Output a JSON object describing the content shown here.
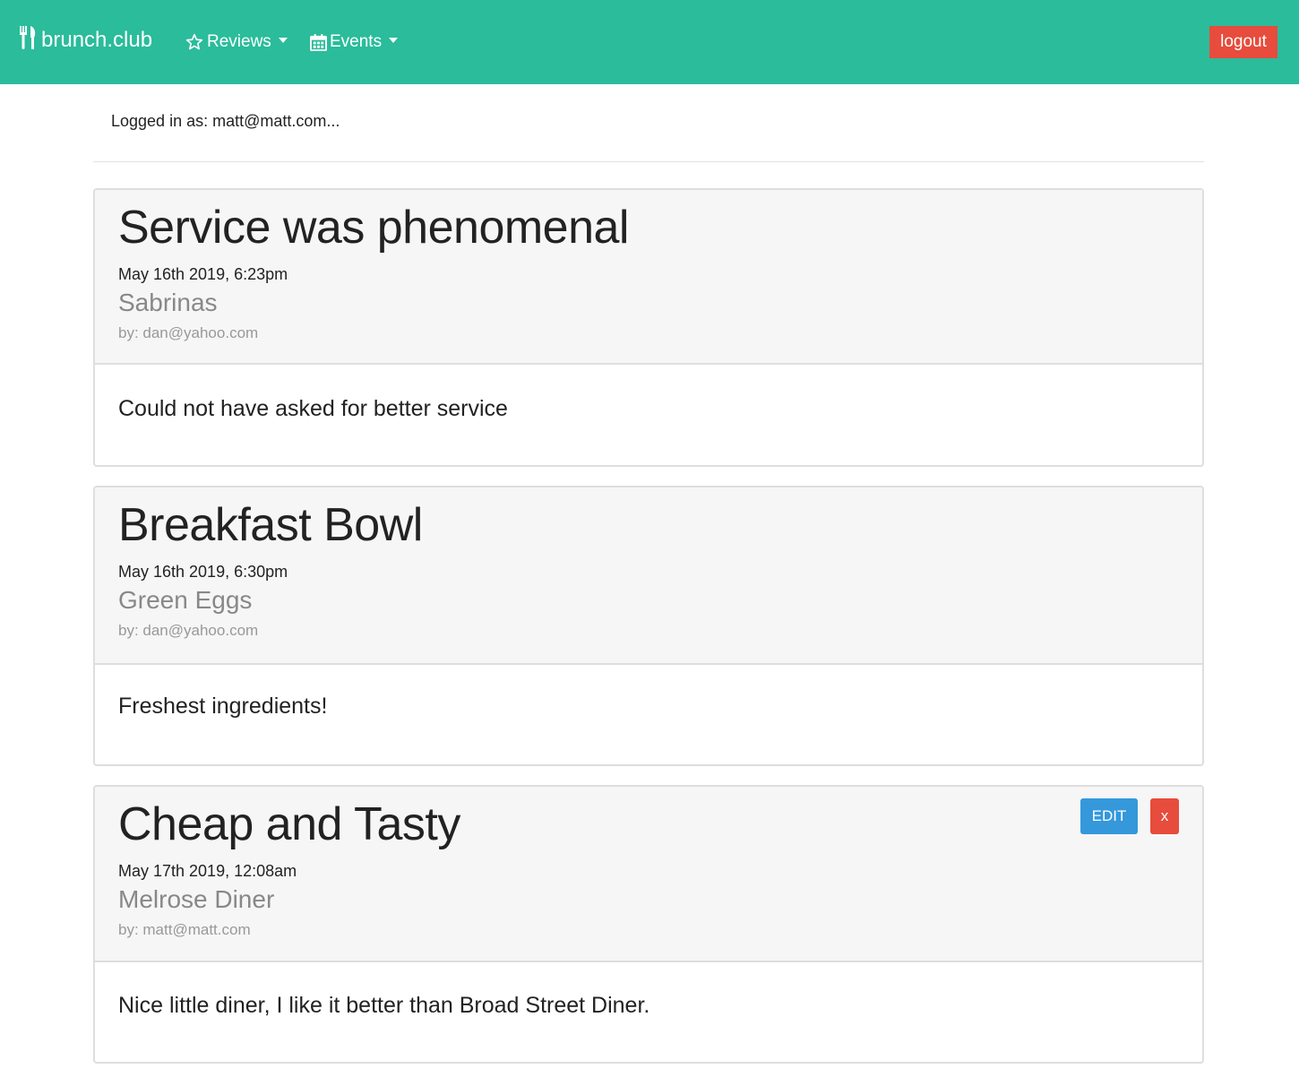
{
  "navbar": {
    "brand": "brunch.club",
    "brand_icon": "utensils-icon",
    "reviews_label": "Reviews",
    "reviews_icon": "star-icon",
    "events_label": "Events",
    "events_icon": "calendar-icon",
    "logout_label": "logout",
    "colors": {
      "background": "#2abc9b",
      "logout": "#e74c3c"
    }
  },
  "status": {
    "logged_in_text": "Logged in as: matt@matt.com..."
  },
  "reviews": [
    {
      "title": "Service was phenomenal",
      "date": "May 16th 2019, 6:23pm",
      "restaurant": "Sabrinas",
      "author": "by: dan@yahoo.com",
      "body": "Could not have asked for better service"
    },
    {
      "title": "Breakfast Bowl",
      "date": "May 16th 2019, 6:30pm",
      "restaurant": "Green Eggs",
      "author": "by: dan@yahoo.com",
      "body": "Freshest ingredients!"
    },
    {
      "title": "Cheap and Tasty",
      "date": "May 17th 2019, 12:08am",
      "restaurant": "Melrose Diner",
      "author": "by: matt@matt.com",
      "body": "Nice little diner, I like it better than Broad Street Diner.",
      "edit_label": "EDIT",
      "delete_label": "x"
    }
  ],
  "colors": {
    "edit_button": "#3498db",
    "delete_button": "#e74c3c",
    "card_header": "#f6f6f6"
  }
}
